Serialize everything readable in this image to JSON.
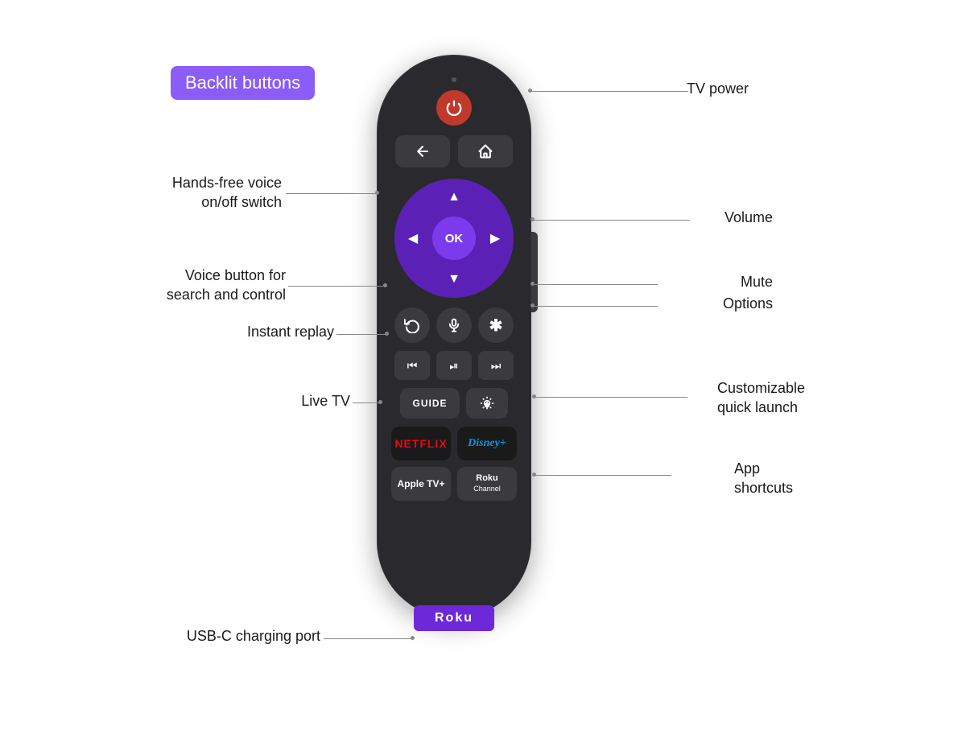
{
  "badge": {
    "label": "Backlit buttons"
  },
  "labels": {
    "tv_power": "TV power",
    "hands_free": "Hands-free voice\non/off switch",
    "volume": "Volume",
    "voice_button": "Voice button for\nsearch and control",
    "mute": "Mute",
    "options": "Options",
    "instant_replay": "Instant replay",
    "live_tv": "Live TV",
    "customizable": "Customizable\nquick launch",
    "app_shortcuts": "App\nshortcuts",
    "usb_c": "USB-C charging port"
  },
  "remote": {
    "power_label": "⏻",
    "back_label": "←",
    "home_label": "⌂",
    "ok_label": "OK",
    "replay_label": "↺",
    "mic_label": "🎤",
    "options_label": "✱",
    "rew_label": "⏮",
    "play_label": "⏯",
    "ff_label": "⏭",
    "guide_label": "GUIDE",
    "netflix_label": "NETFLIX",
    "disney_label": "Disney+",
    "appletv_label": "Apple TV+",
    "roku_channel_label": "Roku\nChannel",
    "roku_logo": "Roku"
  },
  "colors": {
    "badge_bg": "#8B5CF6",
    "remote_body": "#2a2a2e",
    "dpad_bg": "#5b21b6",
    "dpad_ok": "#7c3aed",
    "power_red": "#c0392b",
    "roku_purple": "#6d28d9",
    "netflix_red": "#e50914",
    "disney_blue": "#0096e6"
  }
}
